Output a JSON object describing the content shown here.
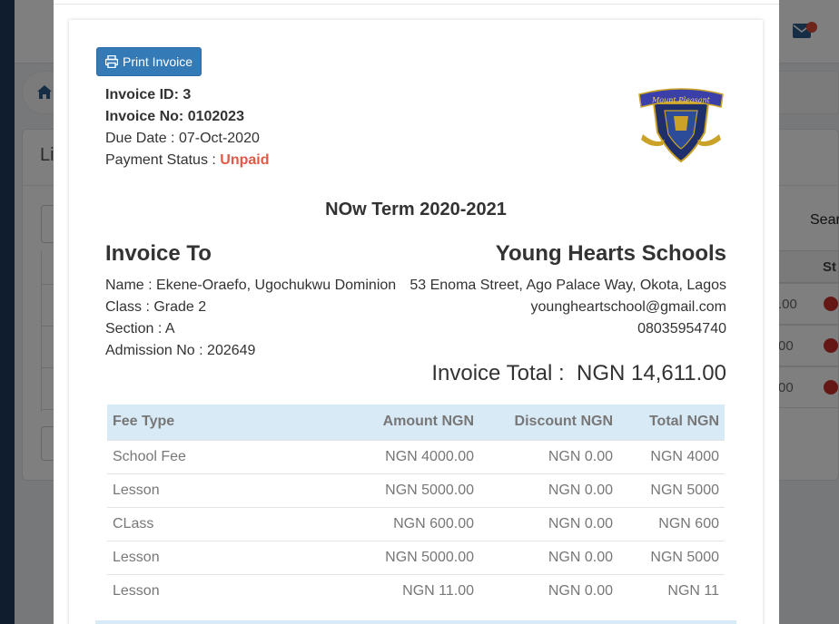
{
  "background": {
    "card_title": "Li",
    "search_label": "Sear",
    "table_header": "St",
    "row_amounts": [
      ".00",
      "00",
      "00"
    ]
  },
  "actions": {
    "print_label": "Print Invoice"
  },
  "invoice": {
    "id_label": "Invoice ID:",
    "id_value": "3",
    "no_label": "Invoice No:",
    "no_value": "0102023",
    "due_label": "Due Date :",
    "due_value": "07-Oct-2020",
    "status_label": "Payment Status :",
    "status_value": "Unpaid",
    "term": "NOw Term 2020-2021",
    "to_heading": "Invoice To",
    "total_label": "Invoice Total :",
    "total_value": "NGN 14,611.00"
  },
  "student": {
    "name_label": "Name :",
    "name_value": "Ekene-Oraefo, Ugochukwu Dominion",
    "class_label": "Class :",
    "class_value": "Grade 2",
    "section_label": "Section :",
    "section_value": "A",
    "admission_label": "Admission No :",
    "admission_value": "202649"
  },
  "school": {
    "name": "Young Hearts Schools",
    "address": "53 Enoma Street, Ago Palace Way, Okota, Lagos",
    "email": "youngheartschool@gmail.com",
    "phone": "08035954740",
    "logo_text": "Mount Pleasant"
  },
  "fees": {
    "headers": [
      "Fee Type",
      "Amount NGN",
      "Discount NGN",
      "Total NGN"
    ],
    "rows": [
      [
        "School Fee",
        "NGN 4000.00",
        "NGN 0.00",
        "NGN 4000"
      ],
      [
        "Lesson",
        "NGN 5000.00",
        "NGN 0.00",
        "NGN 5000"
      ],
      [
        "CLass",
        "NGN 600.00",
        "NGN 0.00",
        "NGN 600"
      ],
      [
        "Lesson",
        "NGN 5000.00",
        "NGN 0.00",
        "NGN 5000"
      ],
      [
        "Lesson",
        "NGN 11.00",
        "NGN 0.00",
        "NGN 11"
      ]
    ]
  },
  "colors": {
    "primary": "#337ab7",
    "unpaid": "#e05a47",
    "table_header_bg": "#d9eaf7"
  }
}
